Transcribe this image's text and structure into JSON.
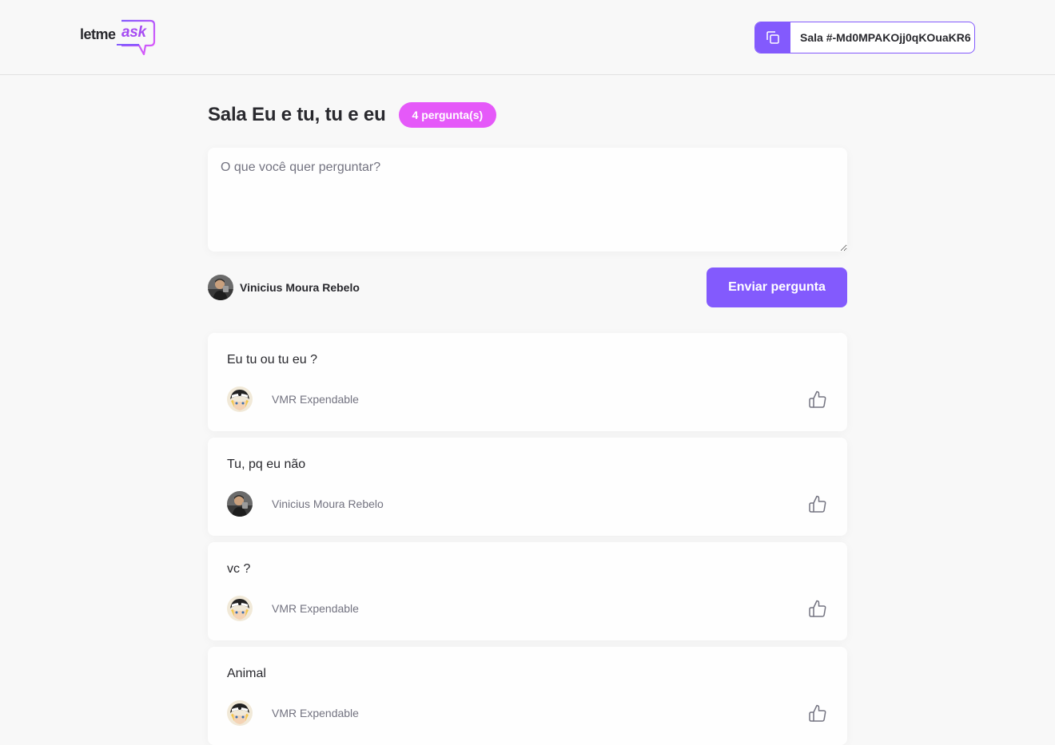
{
  "logo": {
    "part1": "letme",
    "part2": "ask"
  },
  "room_code": {
    "label": "Sala #-Md0MPAKOjj0qKOuaKR6"
  },
  "room": {
    "title": "Sala Eu e tu, tu e eu",
    "question_count": "4 pergunta(s)"
  },
  "form": {
    "placeholder": "O que você quer perguntar?",
    "user_name": "Vinicius Moura Rebelo",
    "submit_label": "Enviar pergunta"
  },
  "questions": [
    {
      "content": "Eu tu ou tu eu ?",
      "author": "VMR Expendable",
      "avatar": "anime-avatar"
    },
    {
      "content": "Tu, pq eu não",
      "author": "Vinicius Moura Rebelo",
      "avatar": "photo-avatar"
    },
    {
      "content": "vc ?",
      "author": "VMR Expendable",
      "avatar": "anime-avatar"
    },
    {
      "content": "Animal",
      "author": "VMR Expendable",
      "avatar": "anime-avatar"
    }
  ],
  "icons": {
    "copy": "copy-icon",
    "like": "thumbs-up-icon"
  },
  "colors": {
    "primary": "#835afd",
    "badge": "#e559f9",
    "logo_accent": "#a64cf3",
    "muted_text": "#737380"
  }
}
